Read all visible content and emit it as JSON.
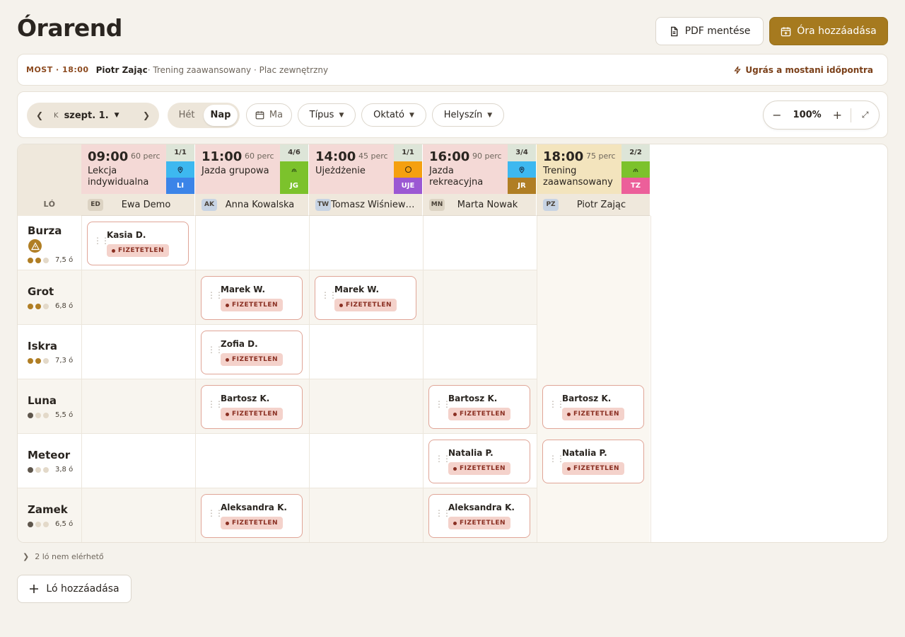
{
  "header": {
    "title": "Órarend",
    "pdf_label": "PDF mentése",
    "add_lesson_label": "Óra hozzáadása"
  },
  "now_bar": {
    "tag": "MOST · 18:00",
    "name": "Piotr Zając",
    "rest": " · Trening zaawansowany · Plac zewnętrzny",
    "jump_label": "Ugrás a mostani időpontra"
  },
  "toolbar": {
    "prev_icon": "chevron-left-icon",
    "next_icon": "chevron-right-icon",
    "day_abbr": "K",
    "date_label": "szept. 1.",
    "view_week": "Hét",
    "view_day": "Nap",
    "today_label": "Ma",
    "filter_type": "Típus",
    "filter_instructor": "Oktató",
    "filter_location": "Helyszín",
    "zoom_value": "100%"
  },
  "grid": {
    "corner_label": "LÓ",
    "lessons": [
      {
        "time": "09:00",
        "duration": "60 perc",
        "name": "Lekcja indywidualna",
        "capacity": "1/1",
        "loc_color": "#3db8f0",
        "code": "LI",
        "code_color": "#3b84e8",
        "loc_icon": "pin-icon"
      },
      {
        "time": "11:00",
        "duration": "60 perc",
        "name": "Jazda grupowa",
        "capacity": "4/6",
        "loc_color": "#7cc22c",
        "code": "JG",
        "code_color": "#7cc22c",
        "loc_icon": "grass-icon"
      },
      {
        "time": "14:00",
        "duration": "45 perc",
        "name": "Ujeżdżenie",
        "capacity": "1/1",
        "loc_color": "#f5a00f",
        "code": "UJE",
        "code_color": "#9b58d3",
        "loc_icon": "circle-icon"
      },
      {
        "time": "16:00",
        "duration": "90 perc",
        "name": "Jazda rekreacyjna",
        "capacity": "3/4",
        "loc_color": "#3db8f0",
        "code": "JR",
        "code_color": "#b07e24",
        "loc_icon": "pin-icon"
      },
      {
        "time": "18:00",
        "duration": "75 perc",
        "name": "Trening zaawansowany",
        "capacity": "2/2",
        "loc_color": "#7cc22c",
        "code": "TZ",
        "code_color": "#ec5f9a",
        "loc_icon": "grass-icon"
      }
    ],
    "instructors": [
      {
        "initials": "ED",
        "name": "Ewa Demo"
      },
      {
        "initials": "AK",
        "name": "Anna Kowalska"
      },
      {
        "initials": "TW",
        "name": "Tomasz Wiśniewski"
      },
      {
        "initials": "MN",
        "name": "Marta Nowak"
      },
      {
        "initials": "PZ",
        "name": "Piotr Zając"
      }
    ],
    "horses": [
      {
        "name": "Burza",
        "level": 2,
        "dark": false,
        "hours": "7,5 ó",
        "warning": true
      },
      {
        "name": "Grot",
        "level": 2,
        "dark": false,
        "hours": "6,8 ó",
        "warning": false
      },
      {
        "name": "Iskra",
        "level": 2,
        "dark": false,
        "hours": "7,3 ó",
        "warning": false
      },
      {
        "name": "Luna",
        "level": 1,
        "dark": true,
        "hours": "5,5 ó",
        "warning": false
      },
      {
        "name": "Meteor",
        "level": 1,
        "dark": true,
        "hours": "3,8 ó",
        "warning": false
      },
      {
        "name": "Zamek",
        "level": 1,
        "dark": true,
        "hours": "6,5 ó",
        "warning": false
      }
    ],
    "status_label": "FIZETETLEN",
    "bookings": [
      {
        "row": 0,
        "col": 0,
        "rider": "Kasia D."
      },
      {
        "row": 1,
        "col": 1,
        "rider": "Marek W."
      },
      {
        "row": 1,
        "col": 2,
        "rider": "Marek W."
      },
      {
        "row": 2,
        "col": 1,
        "rider": "Zofia D."
      },
      {
        "row": 3,
        "col": 1,
        "rider": "Bartosz K."
      },
      {
        "row": 3,
        "col": 3,
        "rider": "Bartosz K."
      },
      {
        "row": 3,
        "col": 4,
        "rider": "Bartosz K."
      },
      {
        "row": 4,
        "col": 3,
        "rider": "Natalia P."
      },
      {
        "row": 4,
        "col": 4,
        "rider": "Natalia P."
      },
      {
        "row": 5,
        "col": 1,
        "rider": "Aleksandra K."
      },
      {
        "row": 5,
        "col": 3,
        "rider": "Aleksandra K."
      }
    ]
  },
  "footer": {
    "unavailable_label": "2 ló nem elérhető",
    "add_horse_label": "Ló hozzáadása"
  }
}
